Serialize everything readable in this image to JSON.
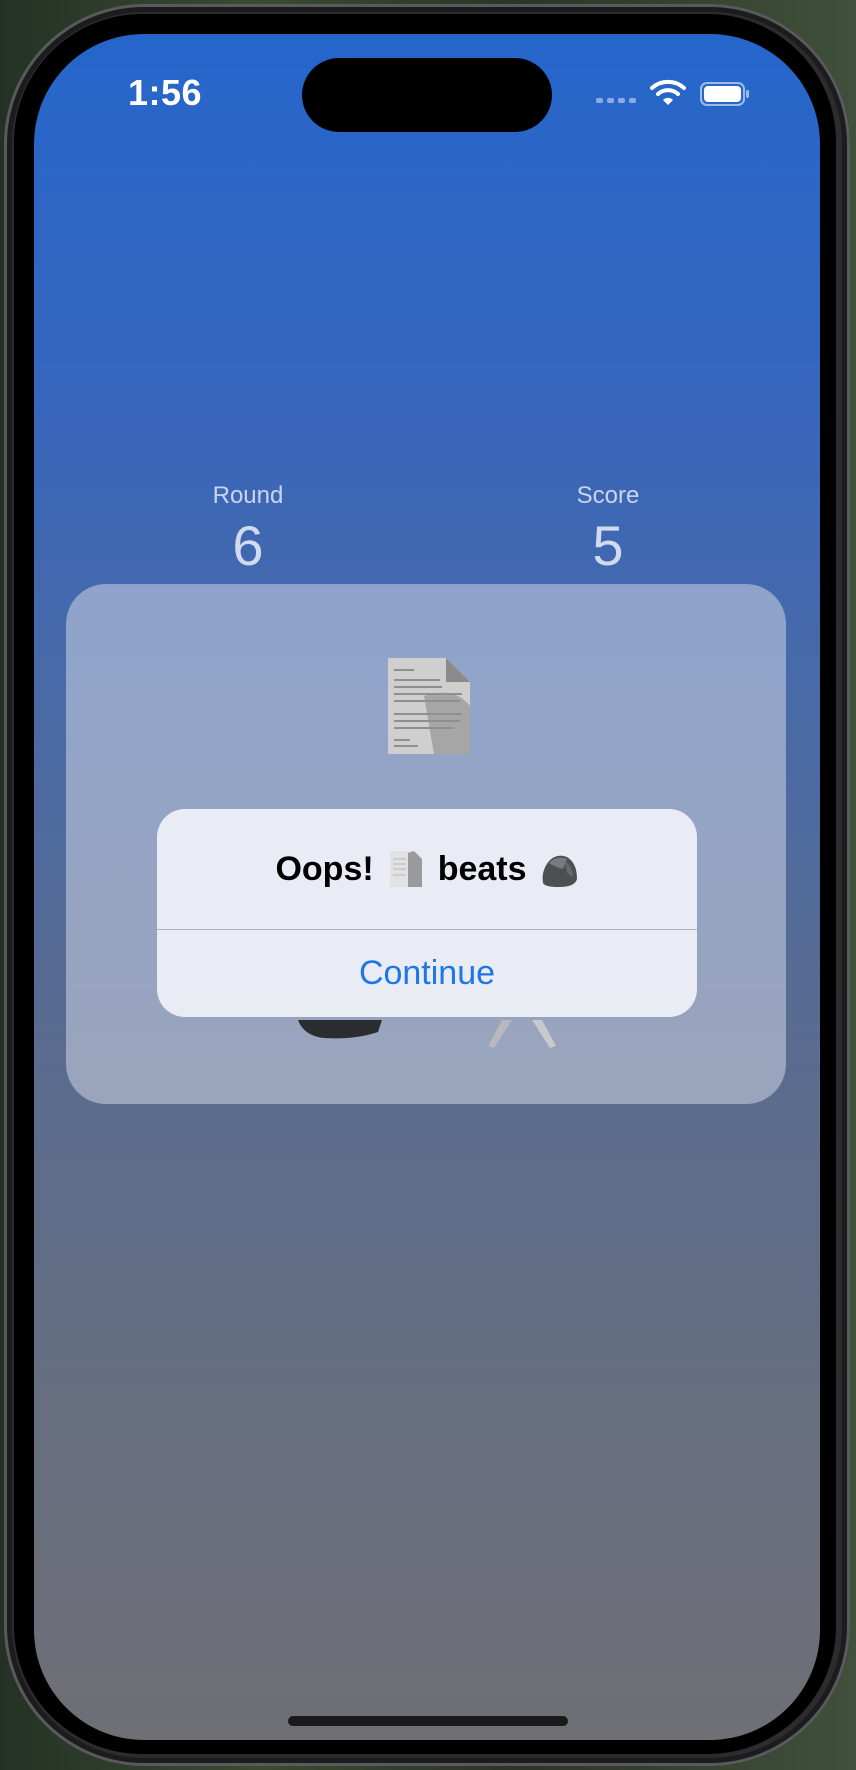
{
  "status_bar": {
    "time": "1:56",
    "icons": [
      "cellular-signal-icon",
      "wifi-icon",
      "battery-icon"
    ]
  },
  "stats": {
    "round_label": "Round",
    "round_value": "6",
    "score_label": "Score",
    "score_value": "5"
  },
  "game": {
    "computer_choice_icon": "paper-document-emoji",
    "player_choices": [
      "rock-emoji",
      "scissors-emoji"
    ]
  },
  "alert": {
    "title_prefix": "Oops!",
    "title_middle": "beats",
    "winner_icon": "paper-document-emoji",
    "loser_icon": "rock-emoji",
    "button_label": "Continue"
  },
  "colors": {
    "background_top": "#2566cb",
    "background_bottom": "#6f6f75",
    "button_text": "#1f77e6"
  }
}
